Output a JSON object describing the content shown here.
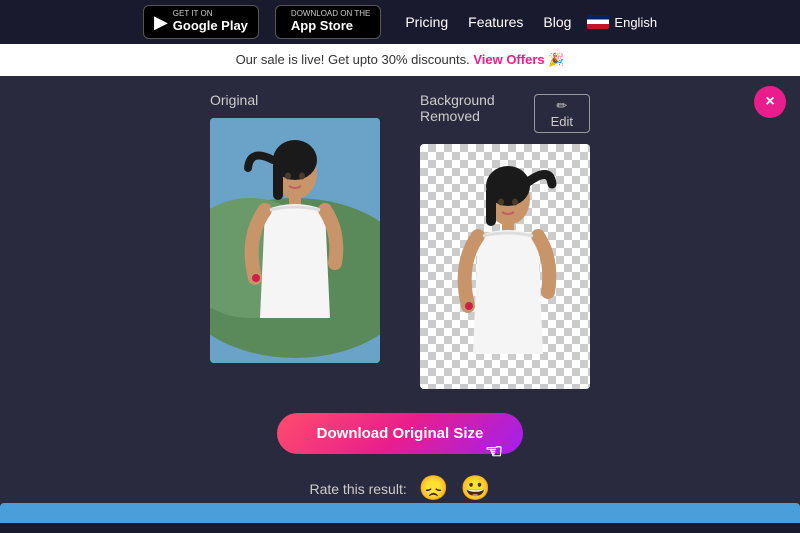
{
  "nav": {
    "google_play_sub": "GET IT ON",
    "google_play_name": "Google Play",
    "app_store_sub": "Download on the",
    "app_store_name": "App Store",
    "links": [
      {
        "id": "pricing",
        "label": "Pricing"
      },
      {
        "id": "features",
        "label": "Features"
      },
      {
        "id": "blog",
        "label": "Blog"
      }
    ],
    "language": "English"
  },
  "sale_banner": {
    "text": "Our sale is live! Get upto 30% discounts.",
    "link_text": "View Offers",
    "emoji": "🎉"
  },
  "main": {
    "close_button": "×",
    "original_label": "Original",
    "removed_label": "Background Removed",
    "edit_button": "✏ Edit",
    "download_button": "Download Original Size",
    "rating_label": "Rate this result:"
  }
}
